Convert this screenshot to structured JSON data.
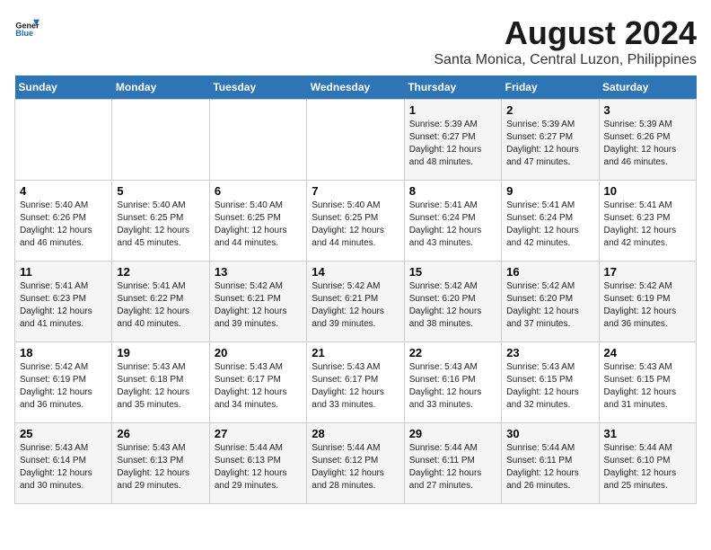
{
  "header": {
    "title": "August 2024",
    "subtitle": "Santa Monica, Central Luzon, Philippines",
    "logo_line1": "General",
    "logo_line2": "Blue"
  },
  "days_of_week": [
    "Sunday",
    "Monday",
    "Tuesday",
    "Wednesday",
    "Thursday",
    "Friday",
    "Saturday"
  ],
  "weeks": [
    [
      {
        "date": "",
        "info": ""
      },
      {
        "date": "",
        "info": ""
      },
      {
        "date": "",
        "info": ""
      },
      {
        "date": "",
        "info": ""
      },
      {
        "date": "1",
        "info": "Sunrise: 5:39 AM\nSunset: 6:27 PM\nDaylight: 12 hours\nand 48 minutes."
      },
      {
        "date": "2",
        "info": "Sunrise: 5:39 AM\nSunset: 6:27 PM\nDaylight: 12 hours\nand 47 minutes."
      },
      {
        "date": "3",
        "info": "Sunrise: 5:39 AM\nSunset: 6:26 PM\nDaylight: 12 hours\nand 46 minutes."
      }
    ],
    [
      {
        "date": "4",
        "info": "Sunrise: 5:40 AM\nSunset: 6:26 PM\nDaylight: 12 hours\nand 46 minutes."
      },
      {
        "date": "5",
        "info": "Sunrise: 5:40 AM\nSunset: 6:25 PM\nDaylight: 12 hours\nand 45 minutes."
      },
      {
        "date": "6",
        "info": "Sunrise: 5:40 AM\nSunset: 6:25 PM\nDaylight: 12 hours\nand 44 minutes."
      },
      {
        "date": "7",
        "info": "Sunrise: 5:40 AM\nSunset: 6:25 PM\nDaylight: 12 hours\nand 44 minutes."
      },
      {
        "date": "8",
        "info": "Sunrise: 5:41 AM\nSunset: 6:24 PM\nDaylight: 12 hours\nand 43 minutes."
      },
      {
        "date": "9",
        "info": "Sunrise: 5:41 AM\nSunset: 6:24 PM\nDaylight: 12 hours\nand 42 minutes."
      },
      {
        "date": "10",
        "info": "Sunrise: 5:41 AM\nSunset: 6:23 PM\nDaylight: 12 hours\nand 42 minutes."
      }
    ],
    [
      {
        "date": "11",
        "info": "Sunrise: 5:41 AM\nSunset: 6:23 PM\nDaylight: 12 hours\nand 41 minutes."
      },
      {
        "date": "12",
        "info": "Sunrise: 5:41 AM\nSunset: 6:22 PM\nDaylight: 12 hours\nand 40 minutes."
      },
      {
        "date": "13",
        "info": "Sunrise: 5:42 AM\nSunset: 6:21 PM\nDaylight: 12 hours\nand 39 minutes."
      },
      {
        "date": "14",
        "info": "Sunrise: 5:42 AM\nSunset: 6:21 PM\nDaylight: 12 hours\nand 39 minutes."
      },
      {
        "date": "15",
        "info": "Sunrise: 5:42 AM\nSunset: 6:20 PM\nDaylight: 12 hours\nand 38 minutes."
      },
      {
        "date": "16",
        "info": "Sunrise: 5:42 AM\nSunset: 6:20 PM\nDaylight: 12 hours\nand 37 minutes."
      },
      {
        "date": "17",
        "info": "Sunrise: 5:42 AM\nSunset: 6:19 PM\nDaylight: 12 hours\nand 36 minutes."
      }
    ],
    [
      {
        "date": "18",
        "info": "Sunrise: 5:42 AM\nSunset: 6:19 PM\nDaylight: 12 hours\nand 36 minutes."
      },
      {
        "date": "19",
        "info": "Sunrise: 5:43 AM\nSunset: 6:18 PM\nDaylight: 12 hours\nand 35 minutes."
      },
      {
        "date": "20",
        "info": "Sunrise: 5:43 AM\nSunset: 6:17 PM\nDaylight: 12 hours\nand 34 minutes."
      },
      {
        "date": "21",
        "info": "Sunrise: 5:43 AM\nSunset: 6:17 PM\nDaylight: 12 hours\nand 33 minutes."
      },
      {
        "date": "22",
        "info": "Sunrise: 5:43 AM\nSunset: 6:16 PM\nDaylight: 12 hours\nand 33 minutes."
      },
      {
        "date": "23",
        "info": "Sunrise: 5:43 AM\nSunset: 6:15 PM\nDaylight: 12 hours\nand 32 minutes."
      },
      {
        "date": "24",
        "info": "Sunrise: 5:43 AM\nSunset: 6:15 PM\nDaylight: 12 hours\nand 31 minutes."
      }
    ],
    [
      {
        "date": "25",
        "info": "Sunrise: 5:43 AM\nSunset: 6:14 PM\nDaylight: 12 hours\nand 30 minutes."
      },
      {
        "date": "26",
        "info": "Sunrise: 5:43 AM\nSunset: 6:13 PM\nDaylight: 12 hours\nand 29 minutes."
      },
      {
        "date": "27",
        "info": "Sunrise: 5:44 AM\nSunset: 6:13 PM\nDaylight: 12 hours\nand 29 minutes."
      },
      {
        "date": "28",
        "info": "Sunrise: 5:44 AM\nSunset: 6:12 PM\nDaylight: 12 hours\nand 28 minutes."
      },
      {
        "date": "29",
        "info": "Sunrise: 5:44 AM\nSunset: 6:11 PM\nDaylight: 12 hours\nand 27 minutes."
      },
      {
        "date": "30",
        "info": "Sunrise: 5:44 AM\nSunset: 6:11 PM\nDaylight: 12 hours\nand 26 minutes."
      },
      {
        "date": "31",
        "info": "Sunrise: 5:44 AM\nSunset: 6:10 PM\nDaylight: 12 hours\nand 25 minutes."
      }
    ]
  ]
}
